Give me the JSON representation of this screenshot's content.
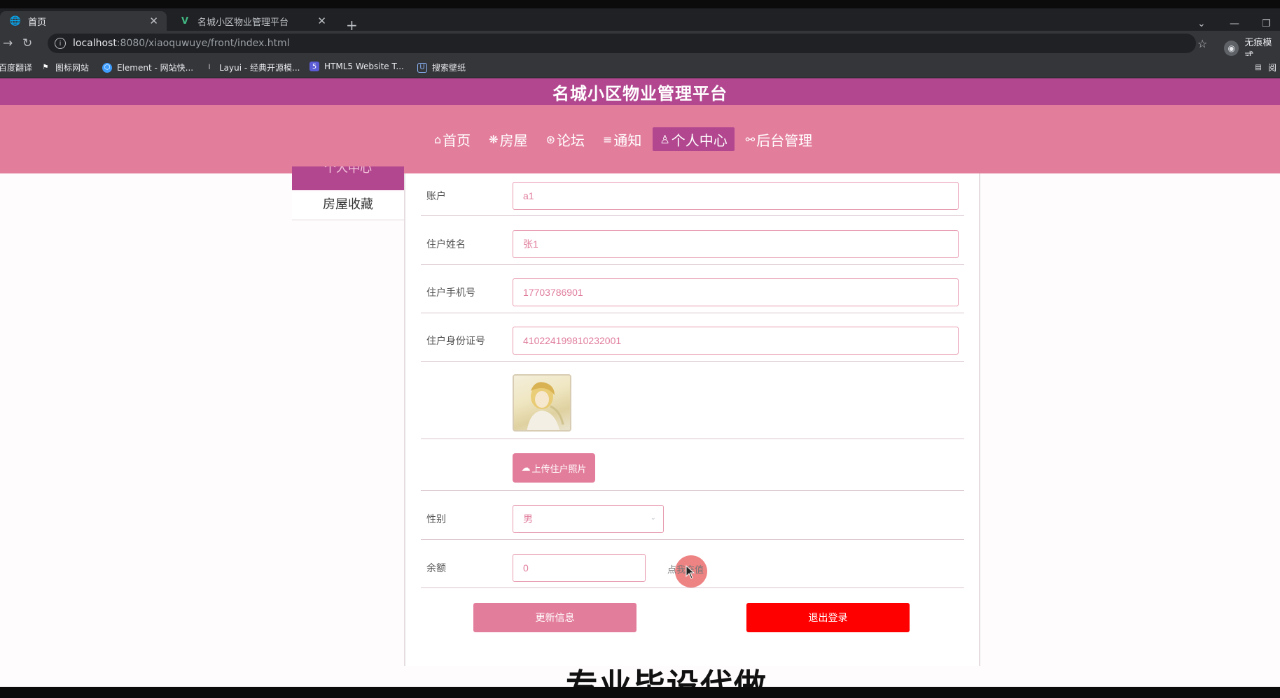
{
  "browser": {
    "tabs": [
      {
        "title": "首页",
        "icon": "globe-icon"
      },
      {
        "title": "名城小区物业管理平台",
        "icon": "vue-icon"
      }
    ],
    "url_host": "localhost",
    "url_rest": ":8080/xiaoquwuye/front/index.html",
    "profile_label": "无痕模式",
    "bookmarks": [
      {
        "label": "百度翻译",
        "icon": ""
      },
      {
        "label": "图标网站",
        "icon": "flag-icon"
      },
      {
        "label": "Element - 网站快...",
        "icon": "element-icon"
      },
      {
        "label": "Layui - 经典开源模...",
        "icon": "layui-icon"
      },
      {
        "label": "HTML5 Website T...",
        "icon": "html5-icon"
      },
      {
        "label": "搜索壁纸",
        "icon": "wallpaper-icon"
      }
    ],
    "bookmarks_right": "阅"
  },
  "site": {
    "title": "名城小区物业管理平台",
    "nav": [
      {
        "label": "首页",
        "icon": "⌂"
      },
      {
        "label": "房屋",
        "icon": "❋"
      },
      {
        "label": "论坛",
        "icon": "⊛"
      },
      {
        "label": "通知",
        "icon": "≡"
      },
      {
        "label": "个人中心",
        "icon": "♙",
        "active": true
      },
      {
        "label": "后台管理",
        "icon": "🔗"
      }
    ]
  },
  "sidebar": {
    "active_label": "个人中心",
    "items": [
      "房屋收藏"
    ]
  },
  "form": {
    "account_label": "账户",
    "account_value": "a1",
    "name_label": "住户姓名",
    "name_value": "张1",
    "phone_label": "住户手机号",
    "phone_value": "17703786901",
    "id_label": "住户身份证号",
    "id_value": "410224199810232001",
    "upload_label": "上传住户照片",
    "gender_label": "性别",
    "gender_value": "男",
    "balance_label": "余额",
    "balance_value": "0",
    "recharge_label": "点我充值",
    "update_button": "更新信息",
    "logout_button": "退出登录"
  },
  "overlay_text": "专业毕设代做"
}
